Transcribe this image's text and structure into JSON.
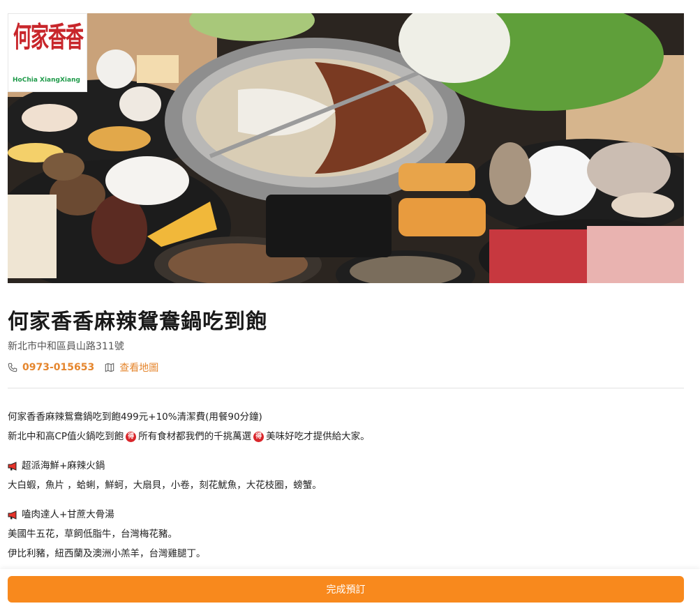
{
  "logo": {
    "main": "何家香香",
    "sub": "HoChia XiangXiang"
  },
  "restaurant": {
    "name": "何家香香麻辣鴛鴦鍋吃到飽",
    "address": "新北市中和區員山路311號",
    "phone": "0973-015653",
    "map_link": "查看地圖"
  },
  "description": {
    "line1": "何家香香麻辣鴛鴦鍋吃到飽499元+10%清潔費(用餐90分鐘)",
    "line2_a": "新北中和高CP值火鍋吃到飽",
    "line2_b": "所有食材都我們的千挑萬選",
    "line2_c": "美味好吃才提供給大家。",
    "badge_char": "得",
    "section1_title": "超派海鮮+麻辣火鍋",
    "section1_text": "大白蝦，魚片 ，蛤蜊，鮮蚵，大扇貝，小卷，刻花魷魚，大花枝圈，螃蟹。",
    "section2_title": "嗑肉達人+甘蔗大骨湯",
    "section2_text1": "美國牛五花，草飼低脂牛，台灣梅花豬。",
    "section2_text2": "伊比利豬，紐西蘭及澳洲小羔羊，台灣雞腿丁。"
  },
  "actions": {
    "book_label": "完成預訂"
  },
  "icons": {
    "phone": "phone-icon",
    "map": "map-icon",
    "megaphone": "megaphone-icon",
    "badge": "de-badge-icon"
  },
  "colors": {
    "accent": "#e5862e",
    "button": "#f8891d",
    "badge": "#d9262b"
  }
}
